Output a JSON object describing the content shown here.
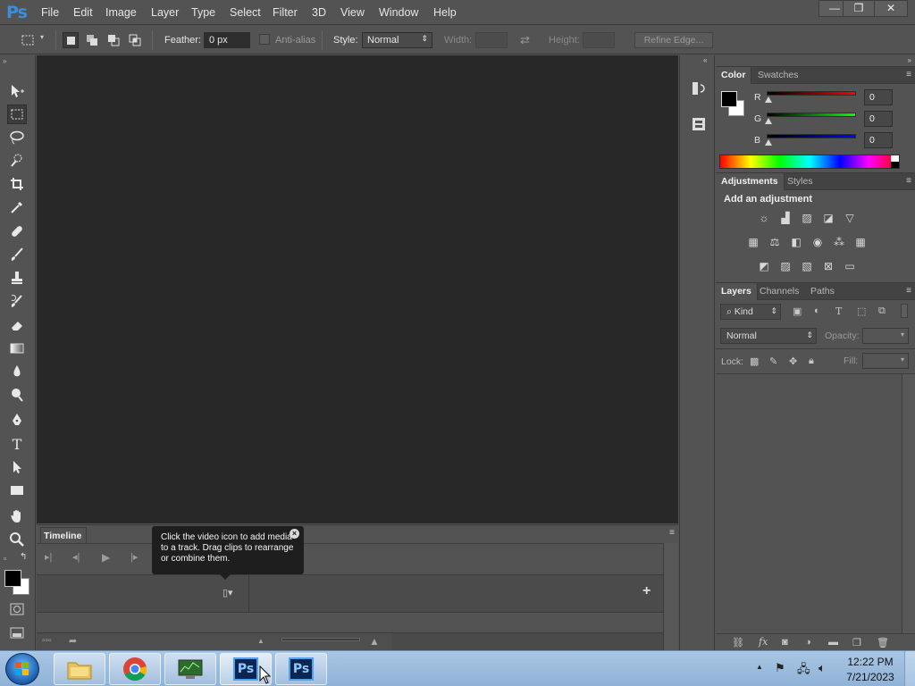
{
  "app": {
    "logo": "Ps"
  },
  "menu": [
    "File",
    "Edit",
    "Image",
    "Layer",
    "Type",
    "Select",
    "Filter",
    "3D",
    "View",
    "Window",
    "Help"
  ],
  "window_controls": {
    "minimize": "—",
    "restore": "❐",
    "close": "✕"
  },
  "options": {
    "feather_label": "Feather:",
    "feather_value": "0 px",
    "antialias_label": "Anti-alias",
    "style_label": "Style:",
    "style_value": "Normal",
    "width_label": "Width:",
    "height_label": "Height:",
    "refine_edge": "Refine Edge..."
  },
  "timeline": {
    "tab": "Timeline",
    "tooltip": "Click the video icon to add media to a track. Drag clips to rearrange or combine them."
  },
  "color_panel": {
    "tabs": [
      "Color",
      "Swatches"
    ],
    "r_label": "R",
    "g_label": "G",
    "b_label": "B",
    "r_value": "0",
    "g_value": "0",
    "b_value": "0"
  },
  "adjustments_panel": {
    "tabs": [
      "Adjustments",
      "Styles"
    ],
    "heading": "Add an adjustment"
  },
  "layers_panel": {
    "tabs": [
      "Layers",
      "Channels",
      "Paths"
    ],
    "kind": "Kind",
    "blend_mode": "Normal",
    "opacity_label": "Opacity:",
    "lock_label": "Lock:",
    "fill_label": "Fill:"
  },
  "taskbar": {
    "ps_label_1": "Ps",
    "ps_label_2": "Ps",
    "time": "12:22 PM",
    "date": "7/21/2023"
  },
  "colors": {
    "accent": "#3a8edb",
    "canvas": "#282828",
    "panel": "#535353"
  }
}
